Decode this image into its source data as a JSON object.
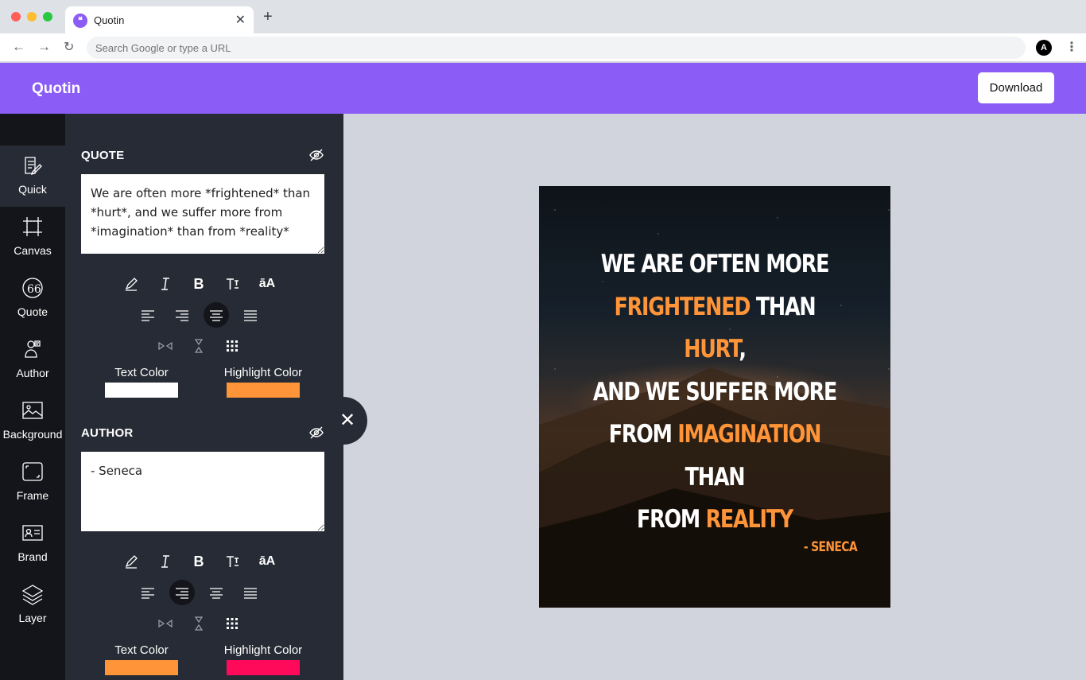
{
  "browser": {
    "tab_title": "Quotin",
    "address_placeholder": "Search Google or type a URL",
    "profile_initial": "A"
  },
  "app": {
    "logo": "Quotin",
    "download_label": "Download",
    "brand_color": "#8b5cf6"
  },
  "rail": {
    "items": [
      {
        "label": "Quick",
        "icon": "pencil-note-icon"
      },
      {
        "label": "Canvas",
        "icon": "crop-frame-icon"
      },
      {
        "label": "Quote",
        "icon": "quote-mark-icon"
      },
      {
        "label": "Author",
        "icon": "author-icon"
      },
      {
        "label": "Background",
        "icon": "image-icon"
      },
      {
        "label": "Frame",
        "icon": "frame-icon"
      },
      {
        "label": "Brand",
        "icon": "id-card-icon"
      },
      {
        "label": "Layer",
        "icon": "layers-icon"
      }
    ],
    "active": "Quick"
  },
  "quote_section": {
    "title": "QUOTE",
    "text": "We are often more *frightened* than *hurt*, and we suffer more from *imagination* than from *reality*",
    "text_color_label": "Text Color",
    "highlight_color_label": "Highlight Color",
    "text_color": "#ffffff",
    "highlight_color": "#ff9438",
    "align_active": "center"
  },
  "author_section": {
    "title": "AUTHOR",
    "text": "- Seneca",
    "text_color_label": "Text Color",
    "highlight_color_label": "Highlight Color",
    "text_color": "#ff9438",
    "highlight_color": "#ff0a5a",
    "align_active": "right"
  },
  "toolbar": {
    "case_label": "āA"
  },
  "poster": {
    "lines": [
      [
        {
          "t": "We are often more",
          "h": false
        }
      ],
      [
        {
          "t": "frightened",
          "h": true
        },
        {
          "t": " than ",
          "h": false
        },
        {
          "t": "hurt",
          "h": true
        },
        {
          "t": ",",
          "h": false
        }
      ],
      [
        {
          "t": "and we suffer more",
          "h": false
        }
      ],
      [
        {
          "t": "from ",
          "h": false
        },
        {
          "t": "imagination",
          "h": true
        },
        {
          "t": " than",
          "h": false
        }
      ],
      [
        {
          "t": "from ",
          "h": false
        },
        {
          "t": "reality",
          "h": true
        }
      ]
    ],
    "author": "- SENECA"
  }
}
